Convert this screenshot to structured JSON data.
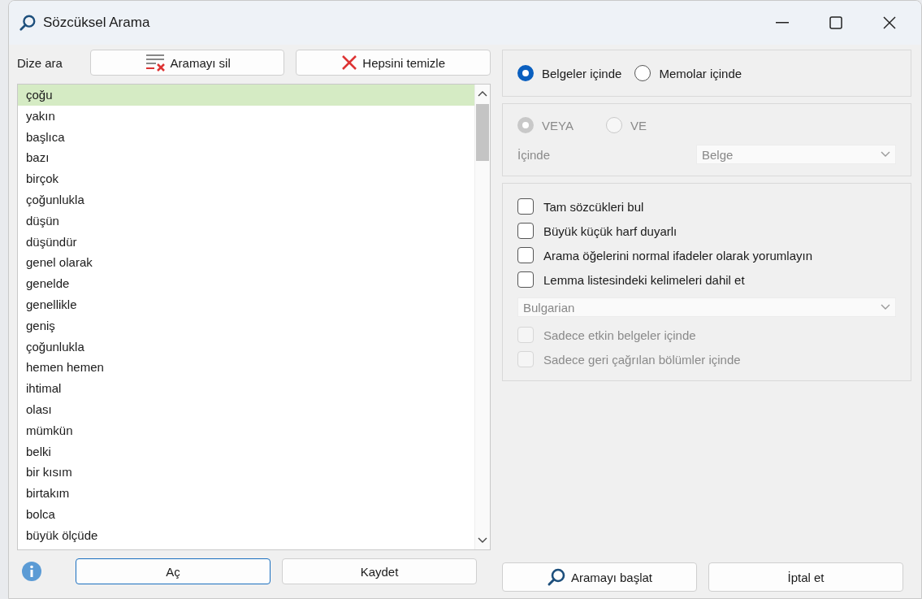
{
  "window": {
    "title": "Sözcüksel Arama"
  },
  "search": {
    "label": "Dize ara",
    "buttons": [
      {
        "kind": "clear-search",
        "label": "Aramayı sil"
      },
      {
        "kind": "clear-all",
        "label": "Hepsini temizle"
      }
    ]
  },
  "terms": [
    {
      "text": "çoğu",
      "selected": true
    },
    {
      "text": "yakın",
      "selected": false
    },
    {
      "text": "başlıca",
      "selected": false
    },
    {
      "text": "bazı",
      "selected": false
    },
    {
      "text": "birçok",
      "selected": false
    },
    {
      "text": "çoğunlukla",
      "selected": false
    },
    {
      "text": "düşün",
      "selected": false
    },
    {
      "text": "düşündür",
      "selected": false
    },
    {
      "text": "genel olarak",
      "selected": false
    },
    {
      "text": "genelde",
      "selected": false
    },
    {
      "text": "genellikle",
      "selected": false
    },
    {
      "text": "geniş",
      "selected": false
    },
    {
      "text": "çoğunlukla",
      "selected": false
    },
    {
      "text": "hemen hemen",
      "selected": false
    },
    {
      "text": "ihtimal",
      "selected": false
    },
    {
      "text": "olası",
      "selected": false
    },
    {
      "text": "mümkün",
      "selected": false
    },
    {
      "text": "belki",
      "selected": false
    },
    {
      "text": "bir kısım",
      "selected": false
    },
    {
      "text": "birtakım",
      "selected": false
    },
    {
      "text": "bolca",
      "selected": false
    },
    {
      "text": "büyük ölçüde",
      "selected": false
    }
  ],
  "scope": [
    {
      "label": "Belgeler içinde",
      "selected": true,
      "disabled": false
    },
    {
      "label": "Memolar içinde",
      "selected": false,
      "disabled": false
    }
  ],
  "operator": [
    {
      "label": "VEYA",
      "selected": true,
      "disabled": true
    },
    {
      "label": "VE",
      "selected": false,
      "disabled": true
    }
  ],
  "inside": {
    "label": "İçinde",
    "value": "Belge",
    "disabled": true
  },
  "options": [
    {
      "label": "Tam sözcükleri bul",
      "checked": false,
      "disabled": false
    },
    {
      "label": "Büyük küçük harf duyarlı",
      "checked": false,
      "disabled": false
    },
    {
      "label": "Arama öğelerini normal ifadeler olarak yorumlayın",
      "checked": false,
      "disabled": false
    },
    {
      "label": "Lemma listesindeki kelimeleri dahil et",
      "checked": false,
      "disabled": false
    }
  ],
  "lemma_language": {
    "value": "Bulgarian",
    "disabled": true
  },
  "restrictions": [
    {
      "label": "Sadece etkin belgeler içinde",
      "checked": false,
      "disabled": true
    },
    {
      "label": "Sadece geri çağrılan bölümler içinde",
      "checked": false,
      "disabled": true
    }
  ],
  "footer_buttons": [
    {
      "kind": "open",
      "label": "Aç",
      "focused": true
    },
    {
      "kind": "save",
      "label": "Kaydet",
      "focused": false
    },
    {
      "kind": "start",
      "label": "Aramayı başlat",
      "focused": false
    },
    {
      "kind": "cancel",
      "label": "İptal et",
      "focused": false
    }
  ]
}
